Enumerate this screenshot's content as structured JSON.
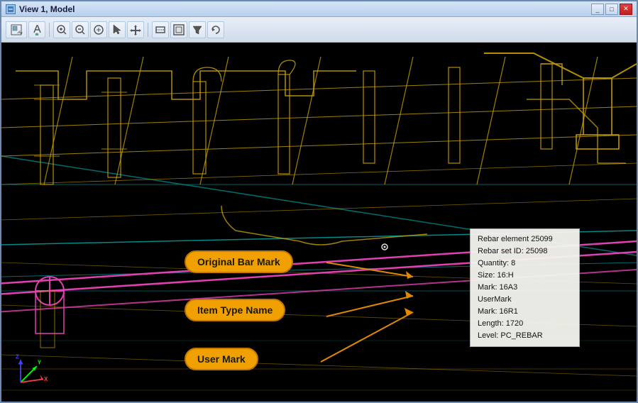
{
  "window": {
    "title": "View 1, Model",
    "icon": "◼"
  },
  "toolbar": {
    "buttons": [
      "▼",
      "🔍",
      "▼",
      "🖌",
      "⊕",
      "⊖",
      "⌀",
      "✋",
      "↔",
      "⬚",
      "⬚",
      "▽",
      "↩",
      "↺"
    ]
  },
  "tooltip": {
    "lines": [
      "Rebar element 25099",
      "Rebar set ID: 25098",
      "Quantity: 8",
      "Size: 16:H",
      "Mark: 16A3",
      "UserMark",
      "Mark: 16R1",
      "Length: 1720",
      "Level: PC_REBAR"
    ]
  },
  "annotations": {
    "original_bar_mark": "Original Bar Mark",
    "item_type_name": "Item Type Name",
    "user_mark": "User Mark"
  },
  "colors": {
    "accent": "#f0a000",
    "rebar_pink": "#e040a0",
    "structure_yellow": "#d4a000",
    "structure_cyan": "#00b8b8",
    "background": "#000000"
  }
}
